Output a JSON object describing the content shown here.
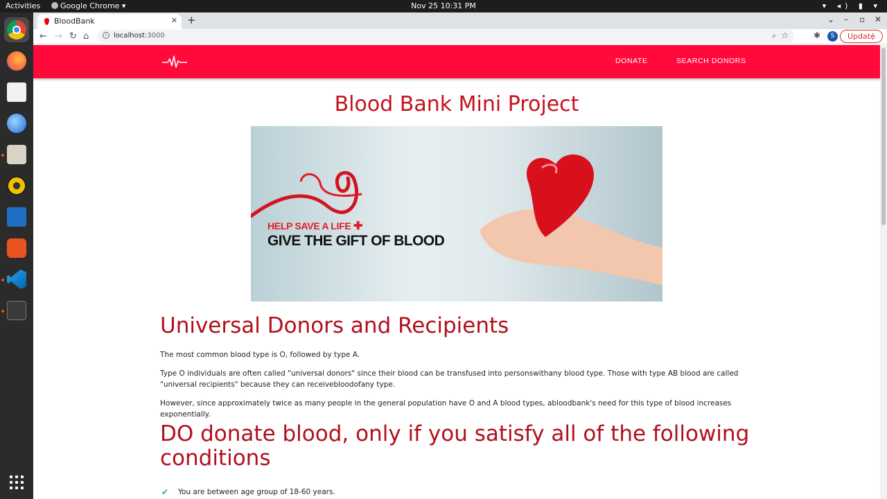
{
  "system": {
    "activities": "Activities",
    "app_menu": "Google Chrome ▾",
    "clock": "Nov 25  10:31 PM"
  },
  "browser": {
    "tab_title": "BloodBank",
    "url_host": "localhost",
    "url_port": ":3000",
    "update_label": "Update",
    "profile_initial": "S"
  },
  "navbar": {
    "links": [
      "DONATE",
      "SEARCH DONORS"
    ]
  },
  "page": {
    "title": "Blood Bank Mini Project",
    "hero_caption_1": "HELP SAVE A LIFE",
    "hero_caption_2": "GIVE THE GIFT OF BLOOD",
    "section1_heading": "Universal Donors and Recipients",
    "paragraphs": [
      "The most common blood type is O, followed by type A.",
      "Type O individuals are often called \"universal donors\" since their blood can be transfused into personswithany blood type. Those with type AB blood are called \"universal recipients\" because they can receivebloodofany type.",
      "However, since approximately twice as many people in the general population have O and A blood types, abloodbank's need for this type of blood increases exponentially."
    ],
    "section2_heading": "DO donate blood, only if you satisfy all of the following conditions",
    "conditions": [
      "You are between age group of 18-60 years."
    ]
  },
  "colors": {
    "navbar": "#ff0a3b",
    "heading": "#b0101c"
  }
}
